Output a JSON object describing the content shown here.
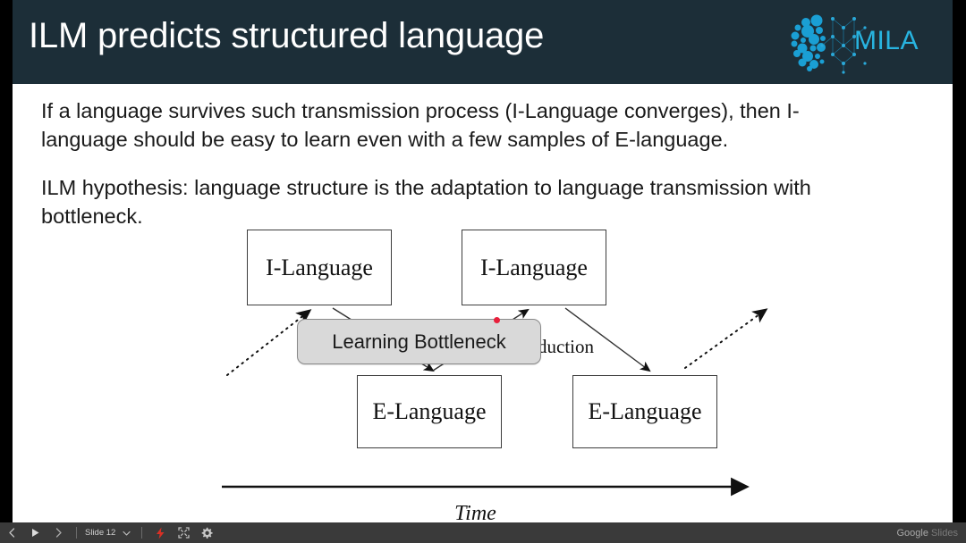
{
  "slide": {
    "title": "ILM predicts structured language",
    "logo": {
      "text": "MILA",
      "color": "#28b4e0",
      "icon": "mila-brain-network-logo"
    },
    "paragraphs": [
      "If a language survives such transmission process (I-Language converges), then I-language should be easy to learn even with a few samples of E-language.",
      "ILM hypothesis: language structure is the adaptation to language transmission with bottleneck."
    ],
    "diagram": {
      "nodes": [
        {
          "id": "i-language-1",
          "label": "I-Language"
        },
        {
          "id": "i-language-2",
          "label": "I-Language"
        },
        {
          "id": "e-language-1",
          "label": "E-Language"
        },
        {
          "id": "e-language-2",
          "label": "E-Language"
        }
      ],
      "edge_label_partial": "duction",
      "overlay": {
        "label": "Learning Bottleneck",
        "fill": "#d9d9d9",
        "marker_color": "#e8203c"
      },
      "axis": {
        "label": "Time",
        "arrow": "right"
      }
    }
  },
  "toolbar": {
    "prev_label": "‹",
    "play_label": "▶",
    "next_label": "›",
    "slide_label": "Slide 12",
    "caret_label": "▾",
    "icons": [
      "lightning-bolt-icon",
      "fullscreen-icon",
      "gear-icon"
    ],
    "branding_google": "Google",
    "branding_slides": "Slides"
  }
}
